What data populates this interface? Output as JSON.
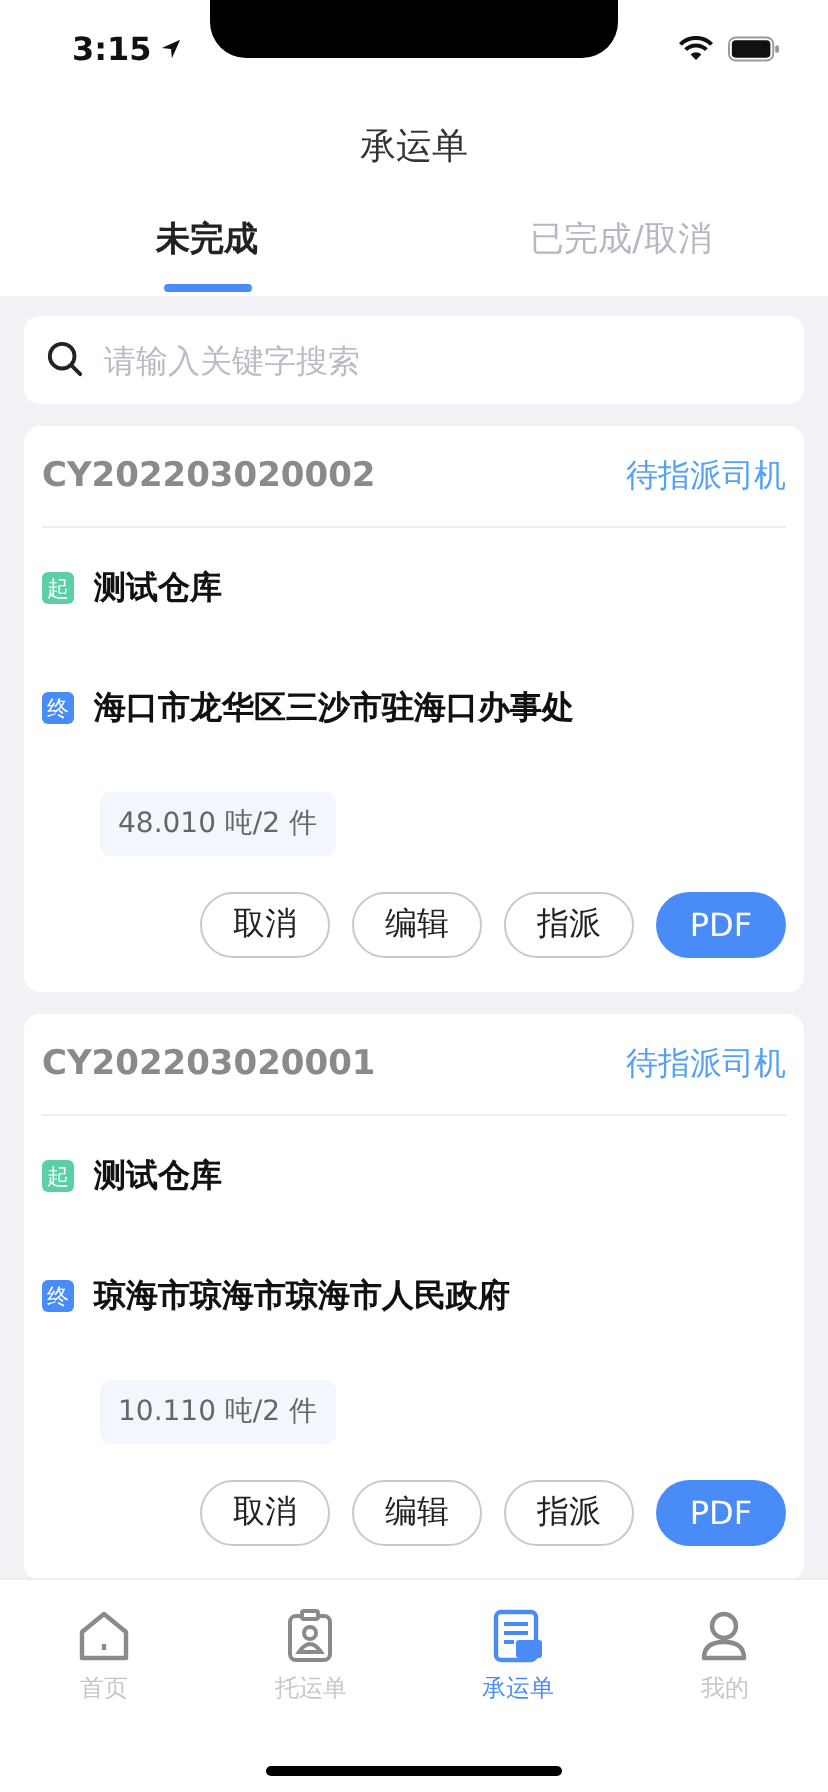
{
  "status_bar": {
    "time": "3:15"
  },
  "title": "承运单",
  "tabs": [
    {
      "label": "未完成",
      "selected": true
    },
    {
      "label": "已完成/取消",
      "selected": false
    }
  ],
  "search": {
    "placeholder": "请输入关键字搜索"
  },
  "orders": [
    {
      "number": "CY202203020002",
      "status": "待指派司机",
      "stops": [
        {
          "kind": "start",
          "badge": "起",
          "place": "测试仓库"
        },
        {
          "kind": "end",
          "badge": "终",
          "place": "海口市龙华区三沙市驻海口办事处"
        }
      ],
      "load": "48.010 吨/2 件",
      "actions": [
        {
          "label": "取消",
          "kind": "outline"
        },
        {
          "label": "编辑",
          "kind": "outline"
        },
        {
          "label": "指派",
          "kind": "outline"
        },
        {
          "label": "PDF",
          "kind": "primary"
        }
      ]
    },
    {
      "number": "CY202203020001",
      "status": "待指派司机",
      "stops": [
        {
          "kind": "start",
          "badge": "起",
          "place": "测试仓库"
        },
        {
          "kind": "end",
          "badge": "终",
          "place": "琼海市琼海市琼海市人民政府"
        }
      ],
      "load": "10.110 吨/2 件",
      "actions": [
        {
          "label": "取消",
          "kind": "outline"
        },
        {
          "label": "编辑",
          "kind": "outline"
        },
        {
          "label": "指派",
          "kind": "outline"
        },
        {
          "label": "PDF",
          "kind": "primary"
        }
      ]
    }
  ],
  "tab_bar": [
    {
      "kind": "home",
      "label": "首页",
      "selected": false
    },
    {
      "kind": "consign",
      "label": "托运单",
      "selected": false
    },
    {
      "kind": "carrier",
      "label": "承运单",
      "selected": true
    },
    {
      "kind": "me",
      "label": "我的",
      "selected": false
    }
  ]
}
